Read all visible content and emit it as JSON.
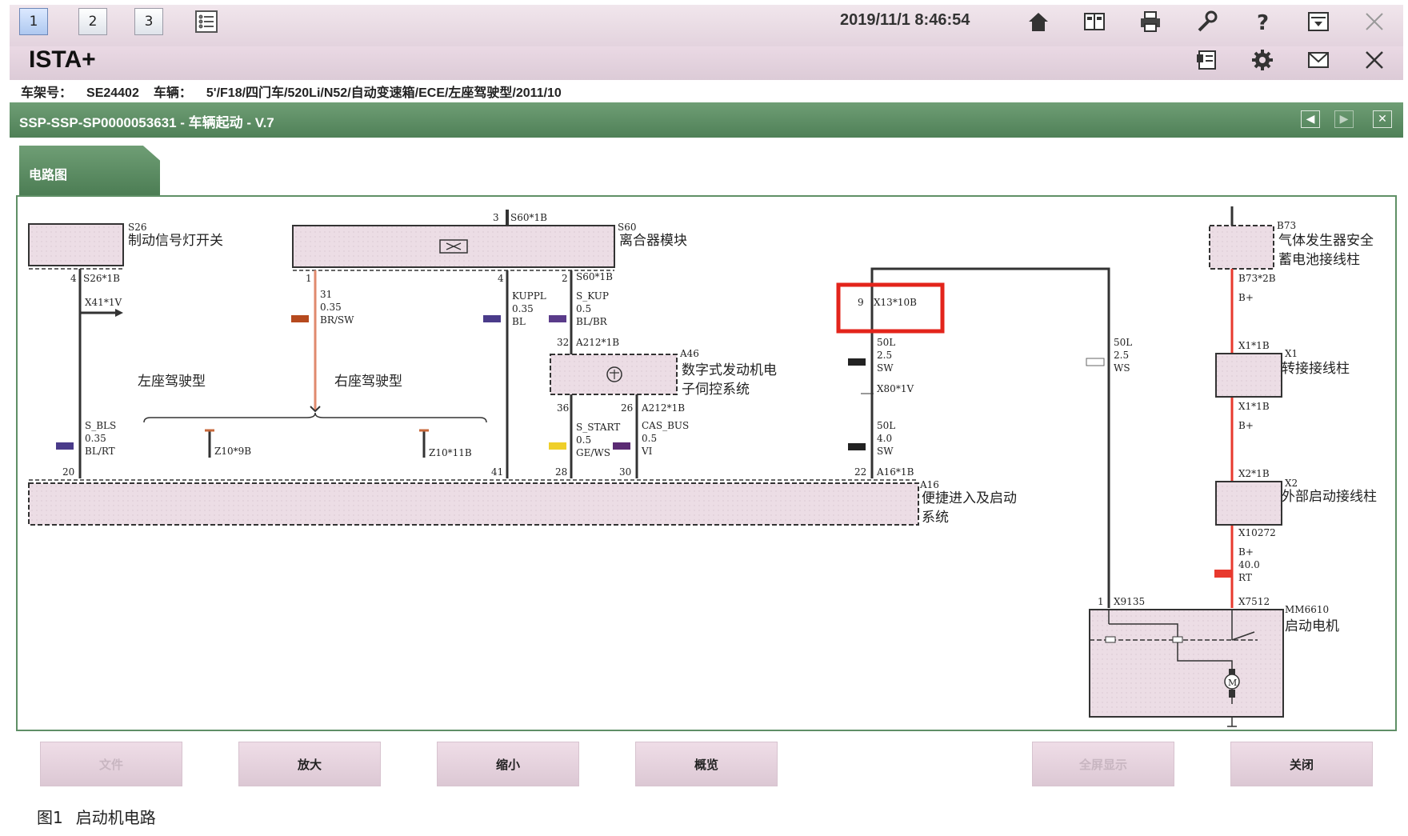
{
  "toolbar": {
    "tabs": [
      "1",
      "2",
      "3"
    ],
    "datetime": "2019/11/1 8:46:54",
    "icons": [
      "list-icon",
      "home-icon",
      "book-icon",
      "printer-icon",
      "wrench-icon",
      "help-icon",
      "download-icon",
      "close-icon"
    ]
  },
  "app": {
    "title": "ISTA+",
    "icons": [
      "manual-icon",
      "gear-icon",
      "mail-icon",
      "close-icon"
    ]
  },
  "vehicle": {
    "vin_label": "车架号：",
    "vin": "SE24402",
    "vehicle_label": "车辆：",
    "vehicle_desc": "5'/F18/四门车/520Li/N52/自动变速箱/ECE/左座驾驶型/2011/10"
  },
  "document": {
    "title": "SSP-SSP-SP0000053631 - 车辆起动 - V.7",
    "nav_prev": "◀",
    "nav_next": "▶",
    "close": "✕"
  },
  "tab": {
    "label": "电路图"
  },
  "diagram": {
    "s26_id": "S26",
    "s26_name": "制动信号灯开关",
    "s60_id": "S60",
    "s60_name": "离合器模块",
    "s60_pin3": "3",
    "s60_conn_top": "S60*1B",
    "b73_id": "B73",
    "b73_name_1": "气体发生器安全",
    "b73_name_2": "蓄电池接线柱",
    "b73_conn": "B73*2B",
    "bplus": "B+",
    "s26_pin": "4",
    "s26_conn": "S26*1B",
    "x41": "X41*1V",
    "w31_pin": "1",
    "w31_1": "31",
    "w31_2": "0.35",
    "w31_3": "BR/SW",
    "kuppl_pin": "4",
    "kuppl_1": "KUPPL",
    "kuppl_2": "0.35",
    "kuppl_3": "BL",
    "skup_pin": "2",
    "skup_conn": "S60*1B",
    "skup_1": "S_KUP",
    "skup_2": "0.5",
    "skup_3": "BL/BR",
    "a212_pin": "32",
    "a212_conn": "A212*1B",
    "a46_id": "A46",
    "a46_name_1": "数字式发动机电",
    "a46_name_2": "子伺控系统",
    "x13_pin": "9",
    "x13_conn": "X13*10B",
    "w50l_a_1": "50L",
    "w50l_a_2": "2.5",
    "w50l_a_3": "SW",
    "x80": "X80*1V",
    "w50l_ws_1": "50L",
    "w50l_ws_2": "2.5",
    "w50l_ws_3": "WS",
    "x1_conn_top": "X1*1B",
    "x1_id": "X1",
    "x1_name": "转接接线柱",
    "x1_conn_bottom": "X1*1B",
    "left_drive": "左座驾驶型",
    "right_drive": "右座驾驶型",
    "a212_lower_pin36": "36",
    "a212_lower_pin26": "26",
    "a212_lower_conn": "A212*1B",
    "sstart_1": "S_START",
    "sstart_2": "0.5",
    "sstart_3": "GE/WS",
    "casbus_1": "CAS_BUS",
    "casbus_2": "0.5",
    "casbus_3": "VI",
    "sbls_1": "S_BLS",
    "sbls_2": "0.35",
    "sbls_3": "BL/RT",
    "z10_9": "Z10*9B",
    "z10_11": "Z10*11B",
    "w50l_b_1": "50L",
    "w50l_b_2": "4.0",
    "w50l_b_3": "SW",
    "x2_conn": "X2*1B",
    "x2_id": "X2",
    "x2_name": "外部启动接线柱",
    "pin20": "20",
    "pin41": "41",
    "pin28": "28",
    "pin30": "30",
    "pin22": "22",
    "a16_conn": "A16*1B",
    "a16_id": "A16",
    "a16_name_1": "便捷进入及启动",
    "a16_name_2": "系统",
    "x10272": "X10272",
    "bp40_1": "B+",
    "bp40_2": "40.0",
    "bp40_3": "RT",
    "x9135_pin": "1",
    "x9135": "X9135",
    "x7512": "X7512",
    "mm_id": "MM6610",
    "mm_name": "启动电机",
    "motor": "M"
  },
  "footer": {
    "buttons": [
      "文件",
      "放大",
      "缩小",
      "概览",
      "全屏显示",
      "关闭"
    ]
  },
  "caption": {
    "fig": "图1",
    "text": "启动机电路"
  },
  "colors": {
    "green_bar": "#5a8a61",
    "red_wire": "#e8392e",
    "highlight": "#e3241b",
    "component_fill": "#ead9e2"
  }
}
